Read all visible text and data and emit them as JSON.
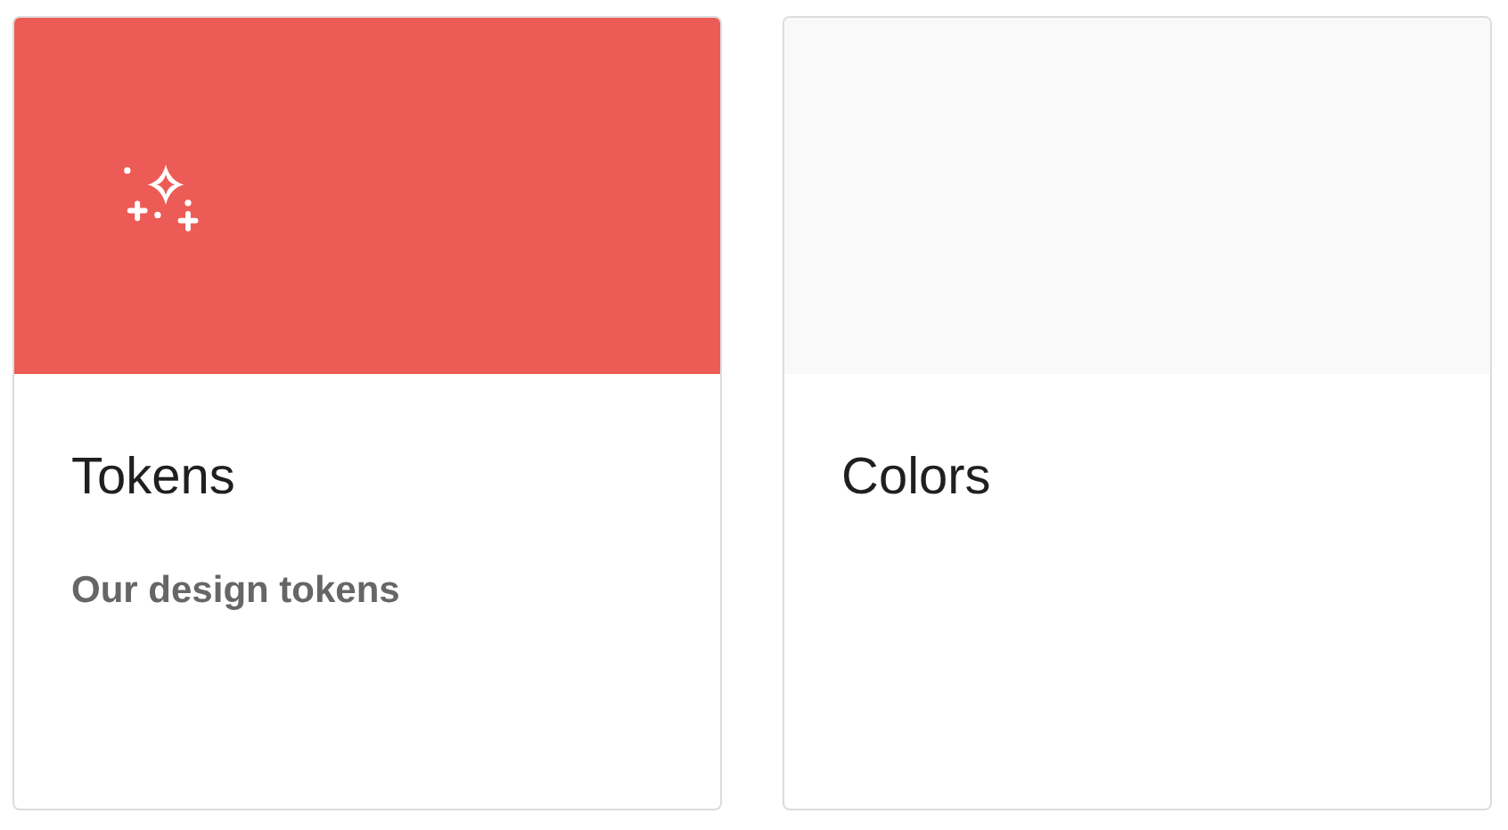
{
  "cards": [
    {
      "title": "Tokens",
      "description": "Our design tokens",
      "color": "#ec5b55",
      "kind": "icon"
    },
    {
      "title": "Colors",
      "color": "#f9f9f9",
      "kind": "plain"
    }
  ]
}
